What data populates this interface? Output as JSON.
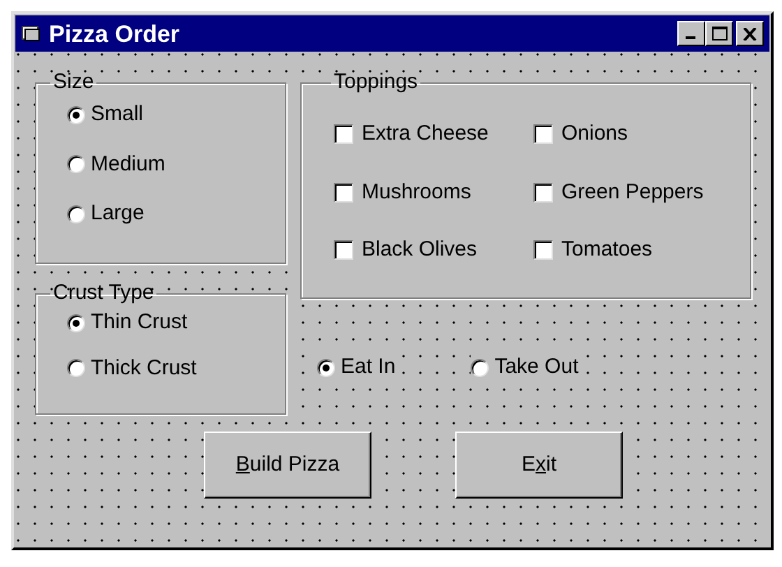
{
  "window": {
    "title": "Pizza Order"
  },
  "size": {
    "title": "Size",
    "options": [
      {
        "label": "Small",
        "selected": true
      },
      {
        "label": "Medium",
        "selected": false
      },
      {
        "label": "Large",
        "selected": false
      }
    ]
  },
  "toppings": {
    "title": "Toppings",
    "items": [
      {
        "label": "Extra Cheese",
        "checked": false
      },
      {
        "label": "Onions",
        "checked": false
      },
      {
        "label": "Mushrooms",
        "checked": false
      },
      {
        "label": "Green Peppers",
        "checked": false
      },
      {
        "label": "Black Olives",
        "checked": false
      },
      {
        "label": "Tomatoes",
        "checked": false
      }
    ]
  },
  "crust": {
    "title": "Crust Type",
    "options": [
      {
        "label": "Thin Crust",
        "selected": true
      },
      {
        "label": "Thick Crust",
        "selected": false
      }
    ]
  },
  "dining": {
    "options": [
      {
        "label": "Eat In",
        "selected": true
      },
      {
        "label": "Take Out",
        "selected": false
      }
    ]
  },
  "buttons": [
    {
      "label": [
        {
          "text": "B",
          "underlined": true
        },
        {
          "text": "uild Pizza",
          "underlined": false
        }
      ]
    },
    {
      "label": [
        {
          "text": "E",
          "underlined": false
        },
        {
          "text": "x",
          "underlined": true
        },
        {
          "text": "it",
          "underlined": false
        }
      ]
    }
  ]
}
